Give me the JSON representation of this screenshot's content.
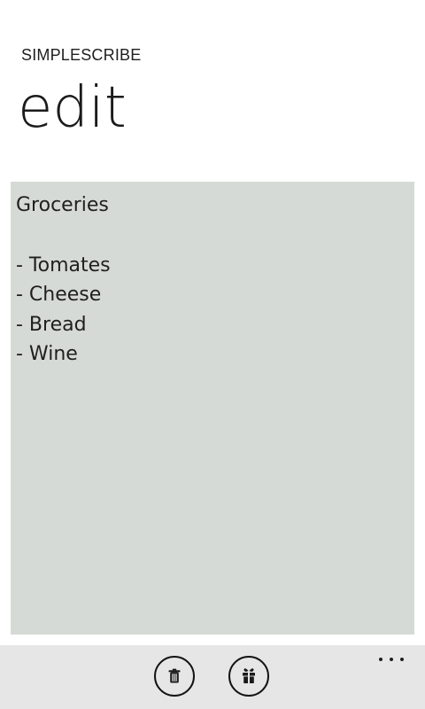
{
  "app": {
    "name": "SIMPLESCRIBE",
    "page_title": "edit"
  },
  "note": {
    "title": "Groceries",
    "lines": [
      "- Tomates",
      "- Cheese",
      "- Bread",
      "- Wine"
    ],
    "background_color": "#d6dad6"
  },
  "app_bar": {
    "buttons": [
      {
        "name": "delete",
        "icon": "trash-icon"
      },
      {
        "name": "gift",
        "icon": "gift-icon"
      }
    ],
    "more_icon": "more-icon",
    "background_color": "#e6e6e6"
  }
}
